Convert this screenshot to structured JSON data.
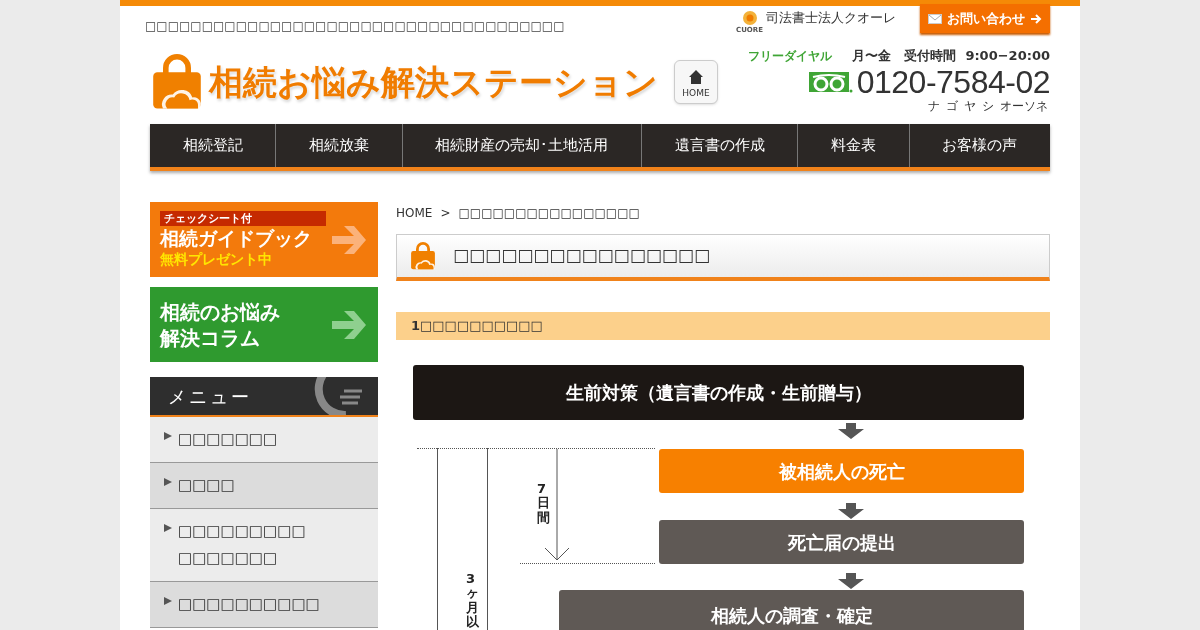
{
  "header": {
    "tagline": "□□□□□□□□□□□□□□□□□□□□□□□□□□□□□□□□□□□□□",
    "site_title": "相続お悩み解決ステーション",
    "home_button": "HOME",
    "firm_logo_text": "CUORE",
    "firm_name": "司法書士法人クオーレ",
    "contact_button": "お問い合わせ",
    "phone": {
      "label": "フリーダイヤル",
      "hours": "月〜金　受付時間  9:00−20:00",
      "number": "0120-7584-02",
      "reading": [
        "ナ",
        "ゴ",
        "ヤ",
        "シ",
        "オーソネ"
      ]
    }
  },
  "nav": [
    {
      "label": "相続登記"
    },
    {
      "label": "相続放棄"
    },
    {
      "label": "相続財産の売却･土地活用"
    },
    {
      "label": "遺言書の作成"
    },
    {
      "label": "料金表"
    },
    {
      "label": "お客様の声"
    }
  ],
  "sidebar": {
    "banners": [
      {
        "kind": "orange",
        "tag": "チェックシート付",
        "title": "相続ガイドブック",
        "subtitle": "無料プレゼント中"
      },
      {
        "kind": "green",
        "title": "相続のお悩み",
        "subtitle": "解決コラム"
      }
    ],
    "menu_title": "メニュー",
    "menu": [
      {
        "lines": [
          "□□□□□□□"
        ]
      },
      {
        "lines": [
          "□□□□"
        ]
      },
      {
        "lines": [
          "□□□□□□□□□",
          "□□□□□□□"
        ]
      },
      {
        "lines": [
          "□□□□□□□□□□"
        ]
      }
    ]
  },
  "breadcrumb": [
    "HOME",
    ">",
    "□□□□□□□□□□□□□□□□"
  ],
  "page_heading": "□□□□□□□□□□□□□□□□",
  "section_heading": "1□□□□□□□□□□",
  "flow": {
    "steps": [
      {
        "kind": "dark",
        "label": "生前対策（遺言書の作成・生前贈与）"
      },
      {
        "kind": "orange",
        "label": "被相続人の死亡"
      },
      {
        "kind": "grey",
        "label": "死亡届の提出"
      },
      {
        "kind": "grey-wide",
        "label": "相続人の調査・確定"
      }
    ],
    "periods": [
      "7日間",
      "3ヶ月以"
    ]
  }
}
